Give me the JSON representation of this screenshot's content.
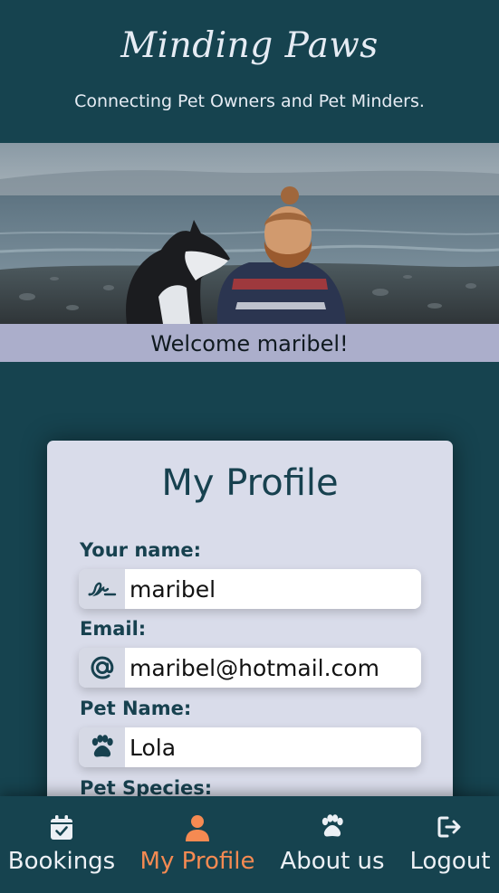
{
  "header": {
    "title": "Minding Paws",
    "tagline": "Connecting Pet Owners and Pet Minders."
  },
  "welcome": "Welcome maribel!",
  "profile": {
    "title": "My Profile",
    "fields": [
      {
        "label": "Your name:",
        "value": "maribel",
        "icon": "signature-icon"
      },
      {
        "label": "Email:",
        "value": "maribel@hotmail.com",
        "icon": "at-icon"
      },
      {
        "label": "Pet Name:",
        "value": "Lola",
        "icon": "paw-icon"
      },
      {
        "label": "Pet Species:"
      }
    ]
  },
  "nav": {
    "items": [
      {
        "label": "Bookings",
        "icon": "calendar-check-icon"
      },
      {
        "label": "My Profile",
        "icon": "user-icon",
        "active": true
      },
      {
        "label": "About us",
        "icon": "paw-icon"
      },
      {
        "label": "Logout",
        "icon": "logout-icon"
      }
    ]
  },
  "colors": {
    "background": "#16434f",
    "welcome_bar": "#abaecb",
    "card": "#d9dcea",
    "active_nav": "#f58a52",
    "text_dark": "#17414f"
  }
}
